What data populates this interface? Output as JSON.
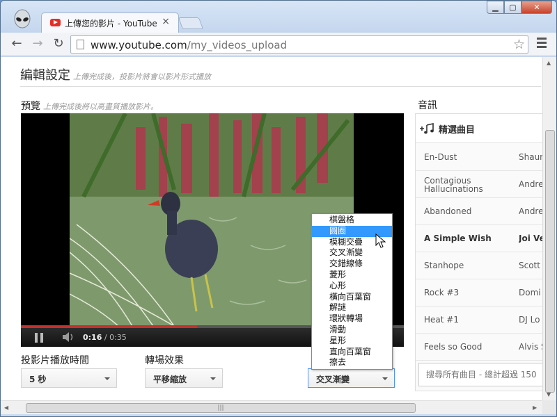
{
  "browser": {
    "tab_title": "上傳您的影片 - YouTube",
    "tab_close": "×",
    "url_host": "www.youtube.com",
    "url_path": "/my_videos_upload",
    "window_buttons": {
      "minimize": "▁",
      "maximize": "▢",
      "close": "✕"
    },
    "nav": {
      "back": "←",
      "forward": "→",
      "reload": "↻",
      "star": "☆"
    }
  },
  "page": {
    "title": "編輯設定",
    "title_hint": "上傳完成後，投影片將會以影片形式播放",
    "preview_label": "預覽",
    "preview_hint": "上傳完成後將以高畫質播放影片。"
  },
  "player": {
    "current_time": "0:16",
    "separator": " / ",
    "duration": "0:35",
    "progress": 0.46
  },
  "settings": {
    "slide_duration": {
      "label": "投影片播放時間",
      "value": "5 秒"
    },
    "transition": {
      "label": "轉場效果",
      "value": "平移縮放"
    },
    "third": {
      "value": "交叉漸變"
    }
  },
  "dropdown": {
    "options": [
      "棋盤格",
      "圓圈",
      "模糊交疊",
      "交叉漸變",
      "交錯線條",
      "菱形",
      "心形",
      "橫向百葉窗",
      "解謎",
      "環狀轉場",
      "滑動",
      "星形",
      "直向百葉窗",
      "擦去"
    ],
    "highlighted_index": 1
  },
  "audio": {
    "title": "音訊",
    "featured_label": "精選曲目",
    "search_placeholder": "搜尋所有曲目 - 總計超過 150",
    "tracks": [
      {
        "title": "En-Dust",
        "artist": "Shaun"
      },
      {
        "title": "Contagious Hallucinations",
        "artist": "Andrew Foust"
      },
      {
        "title": "Abandoned",
        "artist": "Andrew Foust"
      },
      {
        "title": "A Simple Wish",
        "artist": "Joi Ve"
      },
      {
        "title": "Stanhope",
        "artist": "Scott"
      },
      {
        "title": "Rock #3",
        "artist": "Domi"
      },
      {
        "title": "Heat #1",
        "artist": "DJ Lo"
      },
      {
        "title": "Feels so Good",
        "artist": "Alvis S"
      }
    ],
    "bold_track_index": 3
  },
  "colors": {
    "progress": "#c4302b",
    "highlight": "#3399ff",
    "youtube_red": "#e52d27"
  }
}
